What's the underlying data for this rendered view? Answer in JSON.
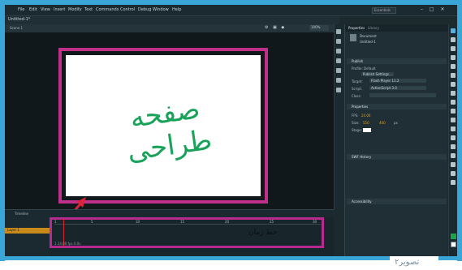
{
  "menu": {
    "items": [
      "File",
      "Edit",
      "View",
      "Insert",
      "Modify",
      "Text",
      "Commands",
      "Control",
      "Debug",
      "Window",
      "Help"
    ],
    "workspace": "Essentials"
  },
  "document": {
    "tab_label": "Untitled-1*",
    "scene_label": "Scene 1",
    "zoom": "100%"
  },
  "stage": {
    "text": "صفحه طراحی",
    "text_color": "#19a35a",
    "highlight_color": "#c0308a"
  },
  "timeline": {
    "tab_label": "Timeline",
    "layer_name": "Layer 1",
    "ticks": [
      "1",
      "5",
      "10",
      "15",
      "20",
      "25",
      "30"
    ],
    "frames_label": "خط زمان",
    "footer": "1  24.00 fps  0.0s"
  },
  "properties": {
    "tab_properties": "Properties",
    "tab_library": "Library",
    "doc_type": "Document",
    "doc_name": "Untitled-1",
    "section_publish": "Publish",
    "profile_label": "Profile: Default",
    "publish_settings": "Publish Settings...",
    "target_label": "Target:",
    "target_value": "Flash Player 11.2",
    "script_label": "Script:",
    "script_value": "ActionScript 3.0",
    "class_label": "Class:",
    "section_properties": "Properties",
    "fps_label": "FPS:",
    "fps_value": "24.00",
    "size_label": "Size:",
    "size_w": "550",
    "size_h": "400",
    "size_unit": "px",
    "stage_label": "Stage:",
    "section_swf": "SWF History",
    "section_accessibility": "Accessibility"
  },
  "caption": "تصویر۲"
}
